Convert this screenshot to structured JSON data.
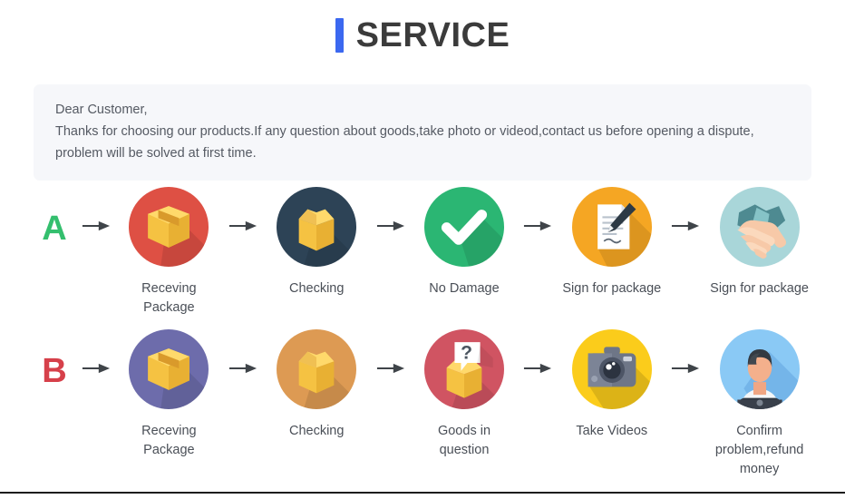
{
  "header": {
    "accent_color": "#3b68f0",
    "title": "SERVICE"
  },
  "notice": {
    "line1": "Dear Customer,",
    "line2": "Thanks for choosing our products.If any question about goods,take photo or videod,contact us before opening a dispute,",
    "line3": "problem will be solved at first time.",
    "background_color": "#f6f7fa"
  },
  "flows": [
    {
      "letter": "A",
      "letter_color": "#34bf6e",
      "steps": [
        {
          "icon": "closed-box-icon",
          "circle_color": "#de5044",
          "label": "Receving Package"
        },
        {
          "icon": "open-box-icon",
          "circle_color": "#2d4356",
          "label": "Checking"
        },
        {
          "icon": "checkmark-icon",
          "circle_color": "#2bb673",
          "label": "No Damage"
        },
        {
          "icon": "document-pen-icon",
          "circle_color": "#f5a623",
          "label": "Sign for package"
        },
        {
          "icon": "handshake-icon",
          "circle_color": "#a9d6d9",
          "label": "Sign for package"
        }
      ]
    },
    {
      "letter": "B",
      "letter_color": "#d6404a",
      "steps": [
        {
          "icon": "closed-box-icon",
          "circle_color": "#6d6cab",
          "label": "Receving Package"
        },
        {
          "icon": "open-box-icon",
          "circle_color": "#dd9a53",
          "label": "Checking"
        },
        {
          "icon": "question-box-icon",
          "circle_color": "#d05462",
          "label": "Goods in question"
        },
        {
          "icon": "camera-icon",
          "circle_color": "#fbcc1b",
          "label": "Take Videos"
        },
        {
          "icon": "support-agent-icon",
          "circle_color": "#8ac9f5",
          "label": "Confirm problem,refund money"
        }
      ]
    }
  ],
  "arrow": {
    "name": "right-arrow-icon",
    "color": "#3f4449"
  }
}
